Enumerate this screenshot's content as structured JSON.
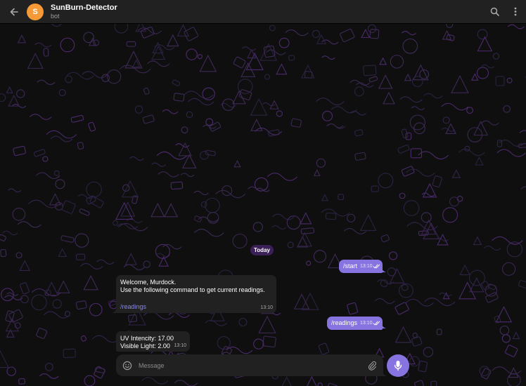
{
  "header": {
    "avatar_letter": "S",
    "title": "SunBurn-Detector",
    "subtitle": "bot",
    "back_icon": "arrow-left-icon",
    "search_icon": "search-icon",
    "more_icon": "more-vertical-icon"
  },
  "colors": {
    "accent": "#8774e1",
    "avatar_orange": "#f59a36",
    "incoming_bubble": "#212121",
    "date_chip": "#3b1f57",
    "header_bg": "#212121",
    "pattern_purple": "#4b2a6b"
  },
  "date_separator": "Today",
  "messages": {
    "start": {
      "text": "/start",
      "time": "13:10"
    },
    "welcome": {
      "line1": "Welcome, Murdock.",
      "line2": "Use the following command to get current readings.",
      "command": "/readings",
      "time": "13:10"
    },
    "readings_out": {
      "text": "/readings",
      "time": "13:10"
    },
    "uv": {
      "line1": "UV Intencity: 17.00",
      "line2": "Visible Light: 2.00",
      "time": "13:10"
    }
  },
  "composer": {
    "placeholder": "Message",
    "emoji_icon": "smile-icon",
    "attach_icon": "paperclip-icon",
    "mic_icon": "microphone-icon"
  }
}
